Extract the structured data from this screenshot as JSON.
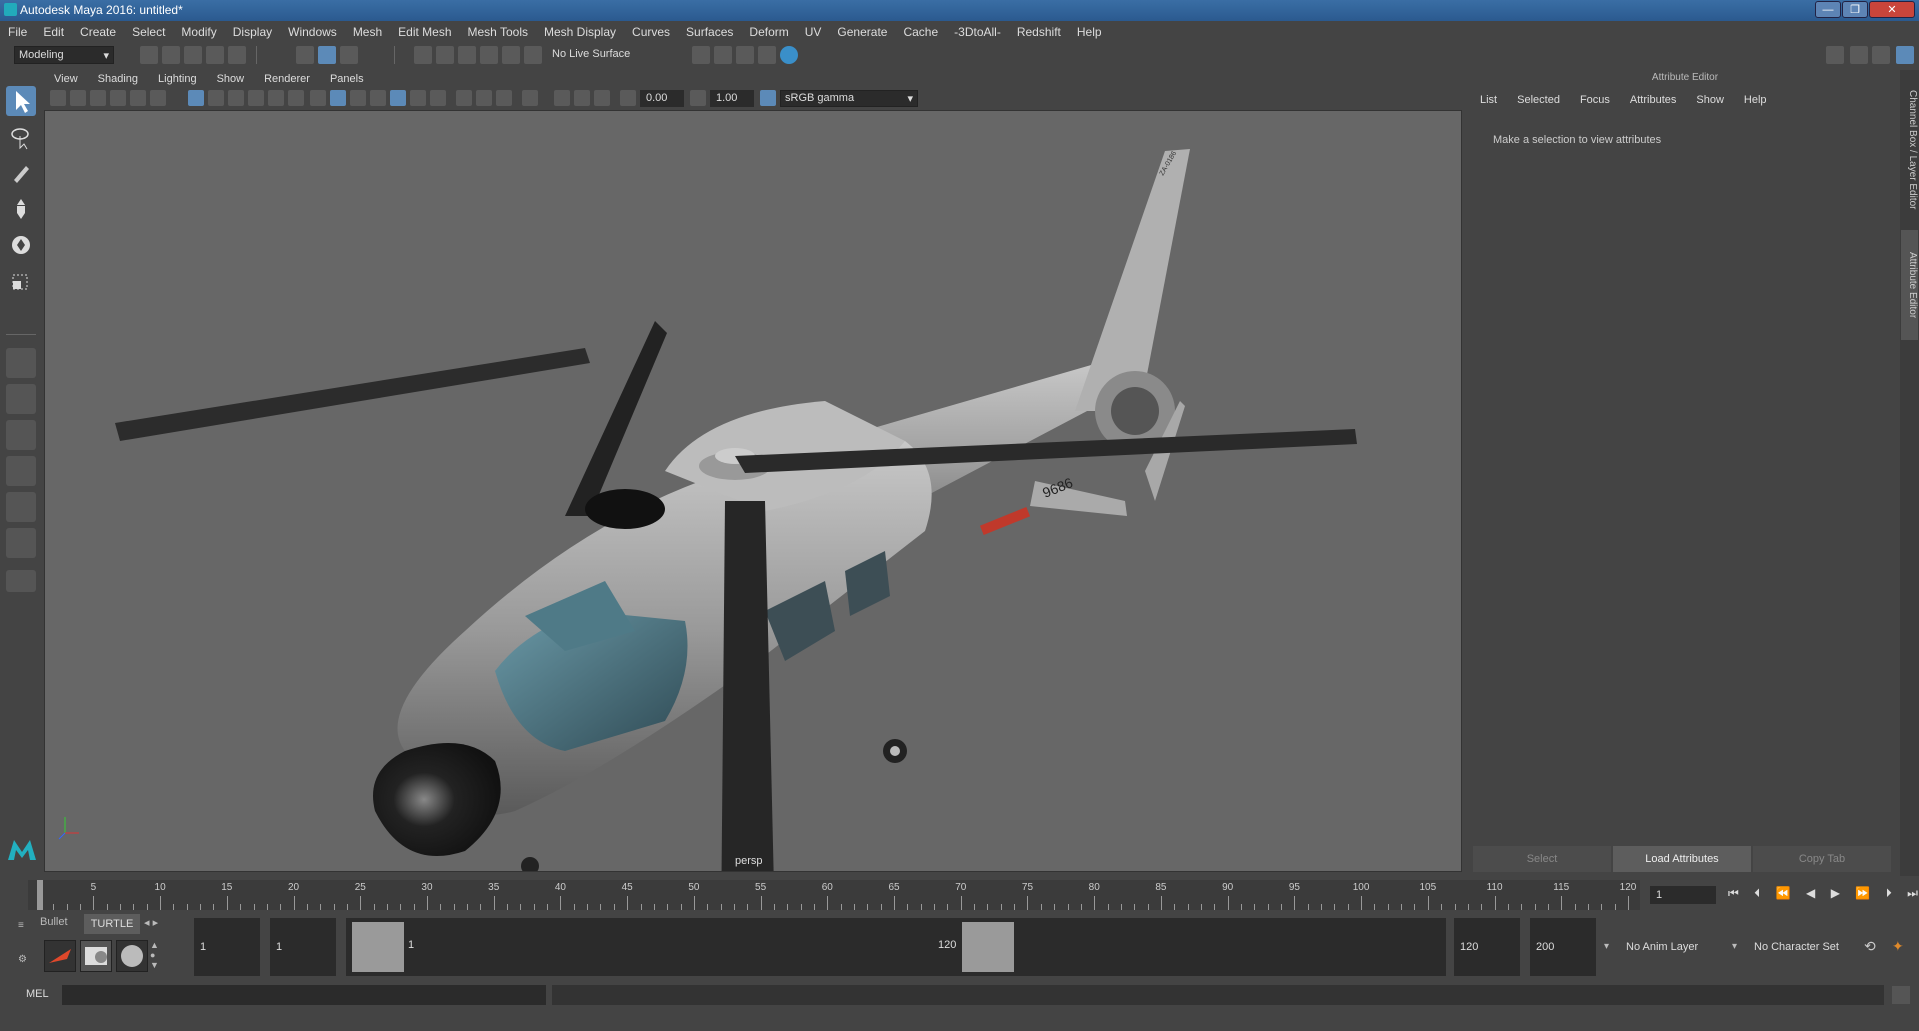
{
  "window": {
    "title": "Autodesk Maya 2016: untitled*"
  },
  "menus": [
    "File",
    "Edit",
    "Create",
    "Select",
    "Modify",
    "Display",
    "Windows",
    "Mesh",
    "Edit Mesh",
    "Mesh Tools",
    "Mesh Display",
    "Curves",
    "Surfaces",
    "Deform",
    "UV",
    "Generate",
    "Cache",
    "-3DtoAll-",
    "Redshift",
    "Help"
  ],
  "statusline": {
    "mode": "Modeling",
    "live_surface": "No Live Surface"
  },
  "panel": {
    "menus": [
      "View",
      "Shading",
      "Lighting",
      "Show",
      "Renderer",
      "Panels"
    ],
    "near_value": "0.00",
    "far_value": "1.00",
    "color_space": "sRGB gamma",
    "camera_label": "persp"
  },
  "attribute_editor": {
    "header": "Attribute Editor",
    "menus": [
      "List",
      "Selected",
      "Focus",
      "Attributes",
      "Show",
      "Help"
    ],
    "message": "Make a selection to view attributes",
    "buttons": {
      "select": "Select",
      "load": "Load Attributes",
      "copy": "Copy Tab"
    },
    "side_tabs": [
      "Channel Box / Layer Editor",
      "Attribute Editor"
    ]
  },
  "timeline": {
    "ticks": [
      "5",
      "10",
      "15",
      "20",
      "25",
      "30",
      "35",
      "40",
      "45",
      "50",
      "55",
      "60",
      "65",
      "70",
      "75",
      "80",
      "85",
      "90",
      "95",
      "100",
      "105",
      "110",
      "115",
      "120"
    ],
    "start_label": "1",
    "current_frame": "1"
  },
  "range": {
    "shelf_tabs": [
      "Bullet",
      "TURTLE"
    ],
    "start_time": "1",
    "playback_start": "1",
    "range_start": "1",
    "range_end": "120",
    "playback_end": "120",
    "end_time": "200",
    "anim_layer": "No Anim Layer",
    "character_set": "No Character Set"
  },
  "cmdline": {
    "label": "MEL"
  },
  "helicopter": {
    "tail_number": "9686",
    "tail_code": "ZA-0186"
  },
  "colors": {
    "accent": "#5c8ab8",
    "viewport_bg": "#676767"
  }
}
